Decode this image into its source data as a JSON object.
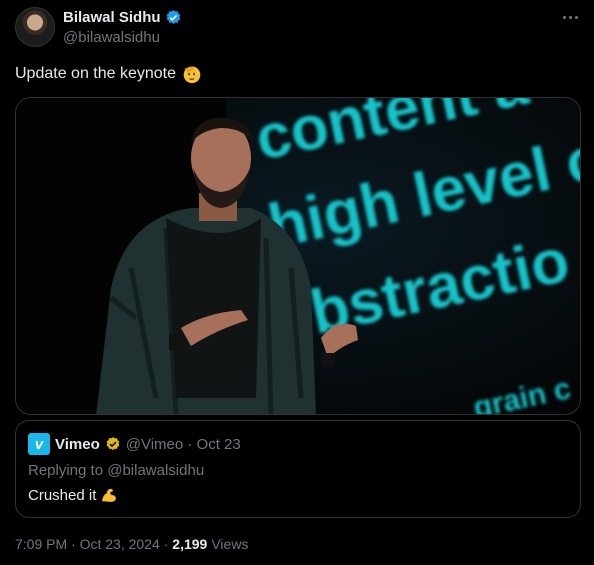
{
  "author": {
    "name": "Bilawal Sidhu",
    "handle": "@bilawalsidhu",
    "verified_color": "#1d9bf0"
  },
  "tweet": {
    "text": "Update on the keynote",
    "emoji": "saluting-face-icon"
  },
  "media": {
    "slide_lines": [
      "content a",
      "high level o",
      "bstractio",
      "grain c"
    ],
    "slide_text_color": "#19c3c8"
  },
  "quote": {
    "name": "Vimeo",
    "logo_letter": "v",
    "handle_date": "@Vimeo · Oct 23",
    "reply_prefix": "Replying to",
    "reply_handle": "@bilawalsidhu",
    "text": "Crushed it",
    "badge_color": "#e2b719"
  },
  "meta": {
    "time_date": "7:09 PM · Oct 23, 2024 ·",
    "views_count": "2,199",
    "views_label": "Views"
  }
}
